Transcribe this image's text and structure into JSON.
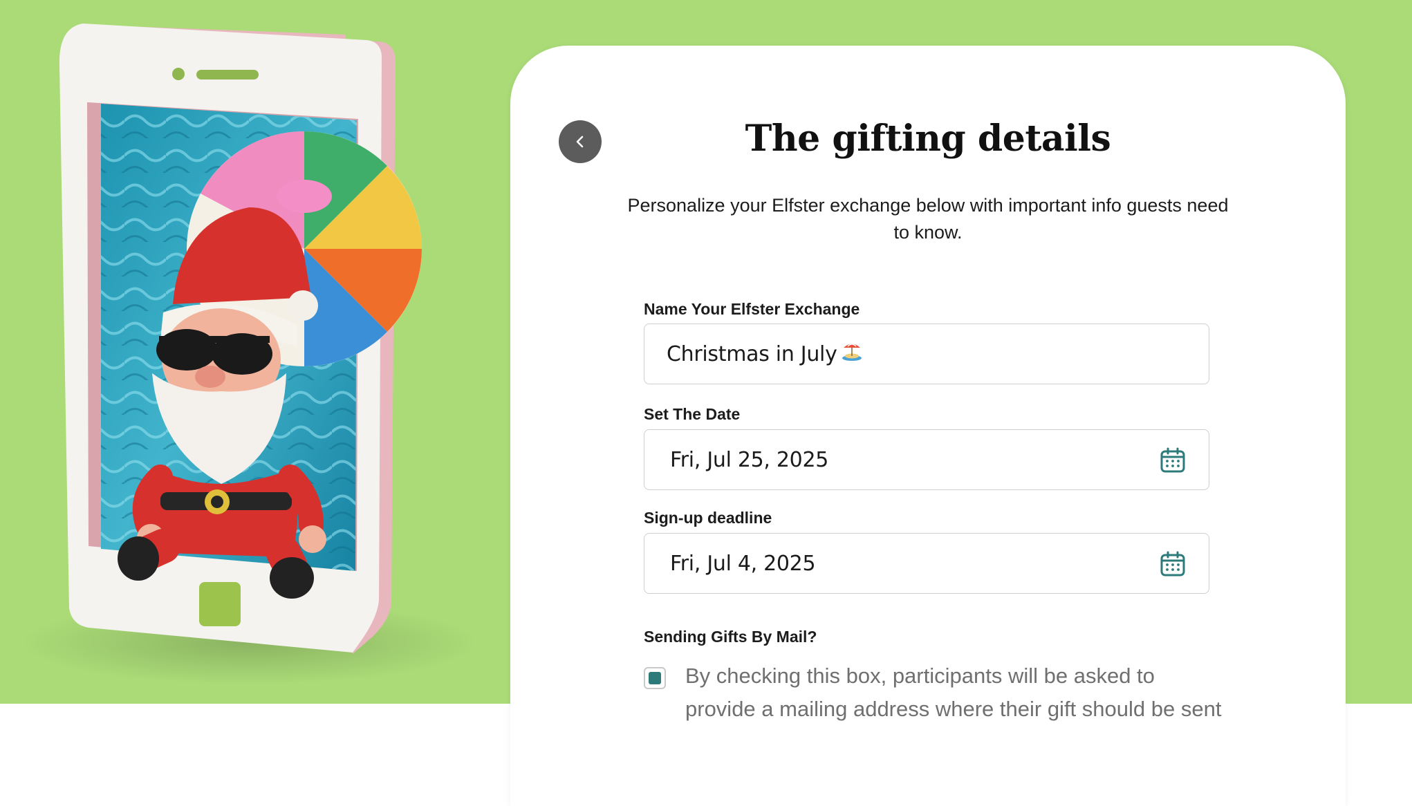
{
  "page": {
    "title": "The gifting details",
    "subtitle": "Personalize your Elfster exchange below with important info guests need to know."
  },
  "form": {
    "name_label": "Name Your Elfster Exchange",
    "name_value": "Christmas in July",
    "name_emoji": "island-beach-umbrella-icon",
    "date_label": "Set The Date",
    "date_value": "Fri, Jul 25, 2025",
    "deadline_label": "Sign-up deadline",
    "deadline_value": "Fri, Jul 4, 2025",
    "mail_label": "Sending Gifts By Mail?",
    "mail_checked": true,
    "mail_text": "By checking this box, participants will be asked to provide a mailing address where their gift should be sent"
  },
  "icons": {
    "back": "chevron-left-icon",
    "calendar": "calendar-icon"
  },
  "colors": {
    "hero_background": "#aadb77",
    "accent_teal": "#2d7a7a",
    "back_button": "#5c5c5c"
  }
}
